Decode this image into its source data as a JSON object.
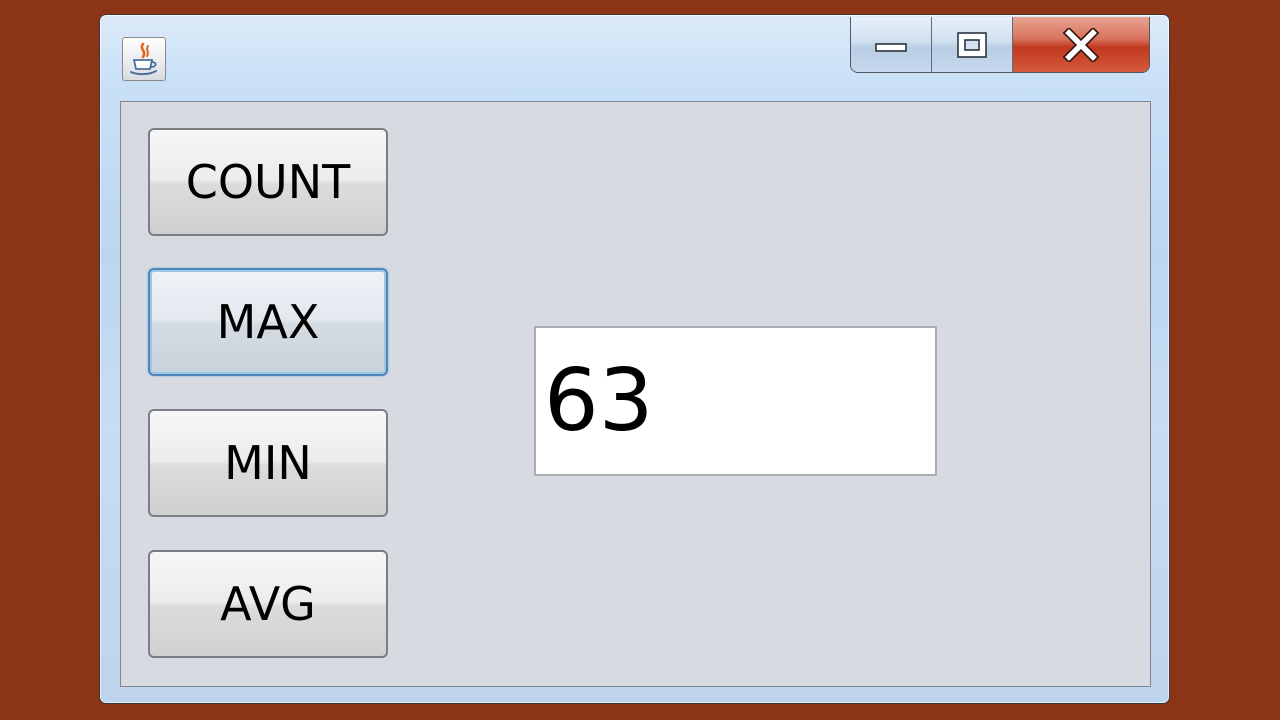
{
  "window": {
    "icon": "java-cup-icon"
  },
  "caption_buttons": {
    "minimize_icon": "minimize-icon",
    "maximize_icon": "maximize-icon",
    "close_icon": "close-icon"
  },
  "buttons": {
    "count_label": "COUNT",
    "max_label": "MAX",
    "min_label": "MIN",
    "avg_label": "AVG"
  },
  "result_field": {
    "value": "63"
  },
  "colors": {
    "desktop_background": "#8b3516",
    "panel_background": "#d7dae1",
    "close_button": "#c2391f"
  }
}
